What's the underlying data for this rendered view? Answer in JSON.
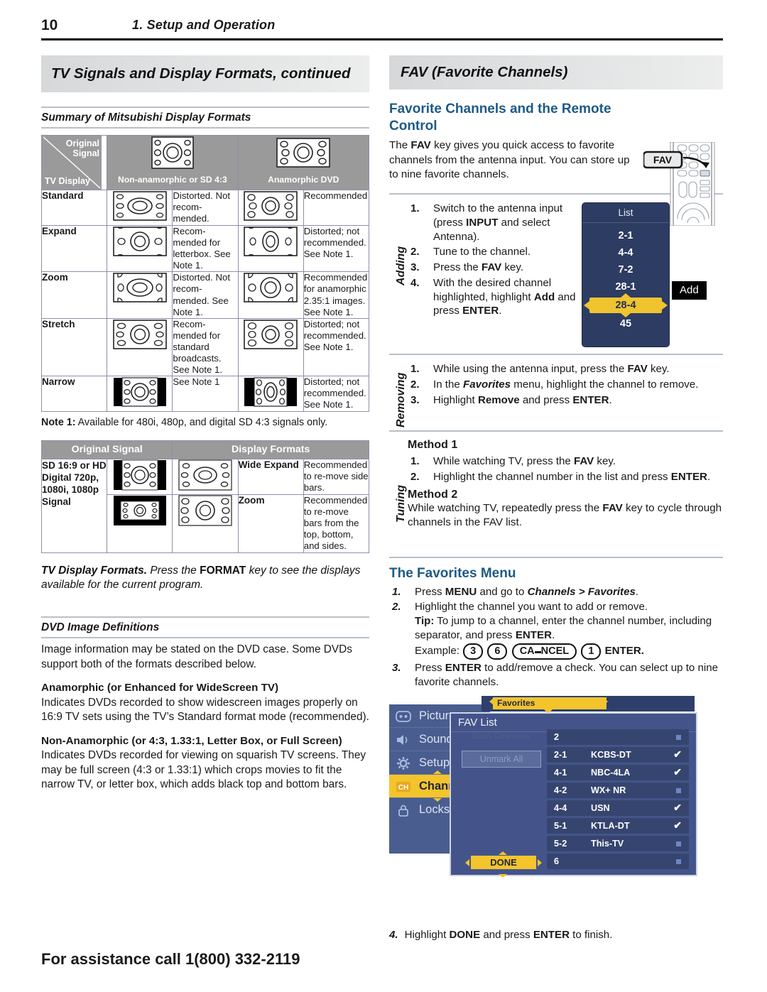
{
  "header": {
    "page_number": "10",
    "chapter": "1.  Setup and Operation"
  },
  "left_column": {
    "section_title": "TV Signals and Display Formats, continued",
    "subhead": "Summary of Mitsubishi Display Formats",
    "table1": {
      "corner_original_signal": "Original Signal",
      "corner_tv_display": "TV Display",
      "col_headers": [
        "Non-anamorphic or SD 4:3",
        "Anamorphic DVD"
      ],
      "rows": [
        {
          "label": "Standard",
          "desc_a": "Distorted. Not recom- mended.",
          "desc_b": "Recommended"
        },
        {
          "label": "Expand",
          "desc_a": "Recom- mended for letterbox.  See Note 1.",
          "desc_b": "Distorted; not recommended. See Note 1."
        },
        {
          "label": "Zoom",
          "desc_a": "Distorted. Not recom- mended.  See Note 1.",
          "desc_b": "Recommended for anamorphic 2.35:1 images. See Note 1."
        },
        {
          "label": "Stretch",
          "desc_a": "Recom- mended for standard broadcasts. See Note 1.",
          "desc_b": "Distorted; not recommended. See Note 1."
        },
        {
          "label": "Narrow",
          "desc_a": "See Note 1",
          "desc_b": "Distorted; not recommended. See Note 1."
        }
      ]
    },
    "note1_label": "Note 1:",
    "note1_text": "Available for 480i, 480p, and digital SD 4:3 signals only.",
    "table2": {
      "header_signal": "Original Signal",
      "header_formats": "Display Formats",
      "signal_label": "SD 16:9 or HD Digital 720p, 1080i, 1080p Signal",
      "rows": [
        {
          "format": "Wide Expand",
          "desc": "Recommended to re-move side bars."
        },
        {
          "format": "Zoom",
          "desc": "Recommended to re-move bars from the top, bottom, and sides."
        }
      ]
    },
    "format_note_bold": "TV Display Formats.",
    "format_note_a": "Press the",
    "format_note_key": "FORMAT",
    "format_note_b": "key to see the displays available for the current program.",
    "dvd_subhead": "DVD Image Definitions",
    "dvd_intro": "Image information may be stated on the DVD case.  Some DVDs support both of the formats described below.",
    "anamorphic_head": "Anamorphic (or Enhanced for WideScreen TV)",
    "anamorphic_body": "Indicates DVDs recorded to show widescreen images properly on 16:9 TV sets using the TV’s Standard format mode (recommended).",
    "nonanamorphic_head": "Non-Anamorphic (or 4:3, 1.33:1, Letter Box, or Full Screen)",
    "nonanamorphic_body": "Indicates DVDs recorded for viewing on squarish TV screens.  They may be full screen (4:3 or 1.33:1) which crops movies to fit the narrow TV, or letter box, which adds black top and bottom bars."
  },
  "right_column": {
    "section_title": "FAV (Favorite Channels)",
    "heading1": "Favorite Channels and the Remote Control",
    "intro_a": "The",
    "intro_key": "FAV",
    "intro_b": "key gives you quick access to favorite channels from the antenna input. You can store up to nine favorite channels.",
    "remote_callout": "FAV",
    "adding": {
      "label": "Adding",
      "steps": [
        {
          "n": "1.",
          "text": "Switch to the antenna input (press INPUT and select Antenna)."
        },
        {
          "n": "2.",
          "text": "Tune to the channel."
        },
        {
          "n": "3.",
          "text": "Press the FAV key."
        },
        {
          "n": "4.",
          "text": "With the desired channel highlighted, highlight Add and press ENTER."
        }
      ]
    },
    "list_osd": {
      "title": "List",
      "channels": [
        "2-1",
        "4-4",
        "7-2",
        "28-1"
      ],
      "selected": "28-4",
      "below": "45",
      "add_button": "Add"
    },
    "removing": {
      "label": "Removing",
      "steps": [
        {
          "n": "1.",
          "text": "While using the antenna input, press the FAV key."
        },
        {
          "n": "2.",
          "text": "In the Favorites menu, highlight the channel to remove."
        },
        {
          "n": "3.",
          "text": "Highlight Remove and press ENTER."
        }
      ]
    },
    "tuning": {
      "label": "Tuning",
      "method1_title": "Method 1",
      "method1_steps": [
        {
          "n": "1.",
          "text": "While watching TV, press the FAV key."
        },
        {
          "n": "2.",
          "text": "Highlight the channel number in the list and press ENTER."
        }
      ],
      "method2_title": "Method 2",
      "method2_text": "While watching TV, repeatedly press the FAV key to cycle through channels in the FAV list."
    },
    "favorites_menu": {
      "heading": "The Favorites Menu",
      "step1_n": "1.",
      "step1_a": "Press",
      "step1_menu": "MENU",
      "step1_b": "and go to",
      "step1_path": "Channels > Favorites",
      "step2_n": "2.",
      "step2_line1": "Highlight the channel you want to add or remove.",
      "step2_tip_label": "Tip:",
      "step2_tip": "To jump to a channel, enter the channel number, including separator, and press ENTER.",
      "example_label": "Example:",
      "example_keys": [
        "3",
        "6",
        "CANCEL",
        "1"
      ],
      "example_enter": "ENTER.",
      "step3_n": "3.",
      "step3_text": "Press ENTER to add/remove a check.  You can select up to nine favorite channels."
    },
    "menu_shot": {
      "sidebar": [
        {
          "label": "Picture",
          "icon": "picture-icon",
          "active": false
        },
        {
          "label": "Sound",
          "icon": "speaker-icon",
          "active": false
        },
        {
          "label": "Setup",
          "icon": "gear-icon",
          "active": false
        },
        {
          "label": "Channels",
          "icon": "ch-icon",
          "active": true
        },
        {
          "label": "Locks",
          "icon": "lock-icon",
          "active": false
        }
      ],
      "favorites_tab": "Favorites",
      "panel_title": "FAV List",
      "scan_label": "Scan Channels",
      "unmark_label": "Unmark All",
      "done_label": "DONE",
      "channels": [
        {
          "num": "2",
          "name": "",
          "checked": false
        },
        {
          "num": "2-1",
          "name": "KCBS-DT",
          "checked": true
        },
        {
          "num": "4-1",
          "name": "NBC-4LA",
          "checked": true
        },
        {
          "num": "4-2",
          "name": "WX+ NR",
          "checked": false
        },
        {
          "num": "4-4",
          "name": "USN",
          "checked": true
        },
        {
          "num": "5-1",
          "name": "KTLA-DT",
          "checked": true
        },
        {
          "num": "5-2",
          "name": "This-TV",
          "checked": false
        },
        {
          "num": "6",
          "name": "",
          "checked": false
        }
      ]
    },
    "last_step_n": "4.",
    "last_step_text": "Highlight DONE and press ENTER to finish."
  },
  "footer": "For assistance call 1(800) 332-2119",
  "colors": {
    "heading_blue": "#1e5a84",
    "osd_blue": "#2d3c62",
    "highlight_yellow": "#f0c330",
    "table_header_gray": "#9a9a9a"
  }
}
